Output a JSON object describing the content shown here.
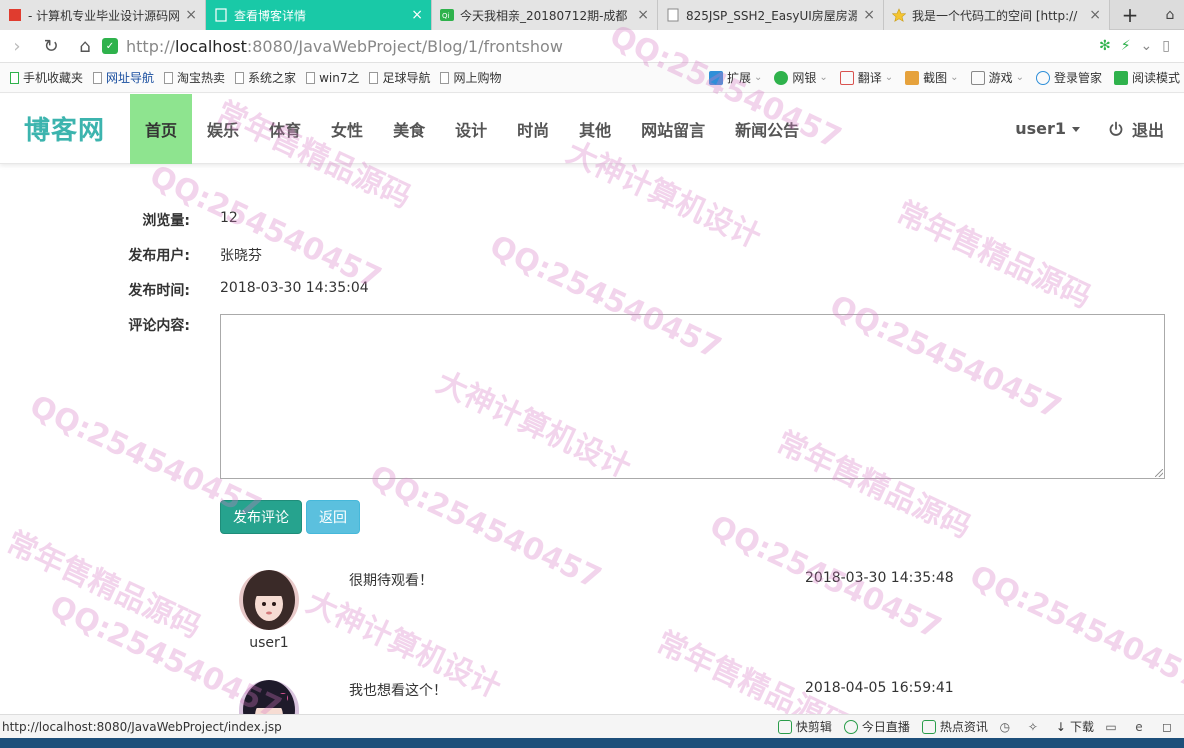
{
  "browser": {
    "tabs": [
      {
        "title": "- 计算机专业毕业设计源码网",
        "icon": "red-flag-icon",
        "active": false
      },
      {
        "title": "查看博客详情",
        "icon": "doc-icon",
        "active": true
      },
      {
        "title": "今天我相亲_20180712期-成都",
        "icon": "video-icon",
        "active": false
      },
      {
        "title": "825JSP_SSH2_EasyUI房屋房源",
        "icon": "doc-icon",
        "active": false
      },
      {
        "title": "我是一个代码工的空间 [http://",
        "icon": "star-icon",
        "active": false
      }
    ],
    "new_tab": "+",
    "address": {
      "scheme": "http://",
      "host": "localhost",
      "rest": ":8080/JavaWebProject/Blog/1/frontshow"
    },
    "bookmarks": [
      "手机收藏夹",
      "网址导航",
      "淘宝热卖",
      "系统之家",
      "win7之",
      "足球导航",
      "网上购物"
    ],
    "toolbar_right": [
      {
        "label": "扩展",
        "icon": "puzzle-icon",
        "color": "#2f8fd8"
      },
      {
        "label": "网银",
        "icon": "bank-icon",
        "color": "#2fb24c"
      },
      {
        "label": "翻译",
        "icon": "translate-icon",
        "color": "#d9534f"
      },
      {
        "label": "截图",
        "icon": "scissors-icon",
        "color": "#e6a23c"
      },
      {
        "label": "游戏",
        "icon": "gamepad-icon",
        "color": "#888888"
      },
      {
        "label": "登录管家",
        "icon": "key-icon",
        "color": "#2f8fd8"
      },
      {
        "label": "阅读模式",
        "icon": "book-icon",
        "color": "#2fb24c"
      }
    ],
    "status_url": "http://localhost:8080/JavaWebProject/index.jsp",
    "status_items": [
      "快剪辑",
      "今日直播",
      "热点资讯",
      "下载"
    ]
  },
  "site": {
    "brand": "博客网",
    "menu": [
      "首页",
      "娱乐",
      "体育",
      "女性",
      "美食",
      "设计",
      "时尚",
      "其他",
      "网站留言",
      "新闻公告"
    ],
    "active_menu": "首页",
    "user": "user1",
    "logout": "退出",
    "accent": "#3cb4ae",
    "active_bg": "#8ee48f"
  },
  "detail": {
    "views_label": "浏览量:",
    "views": "12",
    "author_label": "发布用户:",
    "author": "张晓芬",
    "time_label": "发布时间:",
    "time": "2018-03-30 14:35:04",
    "comment_label": "评论内容:",
    "comment_value": "",
    "submit_label": "发布评论",
    "back_label": "返回"
  },
  "comments": [
    {
      "user": "user1",
      "text": "很期待观看！",
      "time": "2018-03-30 14:35:48"
    },
    {
      "user": "",
      "text": "我也想看这个！",
      "time": "2018-04-05 16:59:41"
    }
  ],
  "watermark": [
    "QQ:254540457",
    "大神计算机设计",
    "常年售精品源码"
  ]
}
